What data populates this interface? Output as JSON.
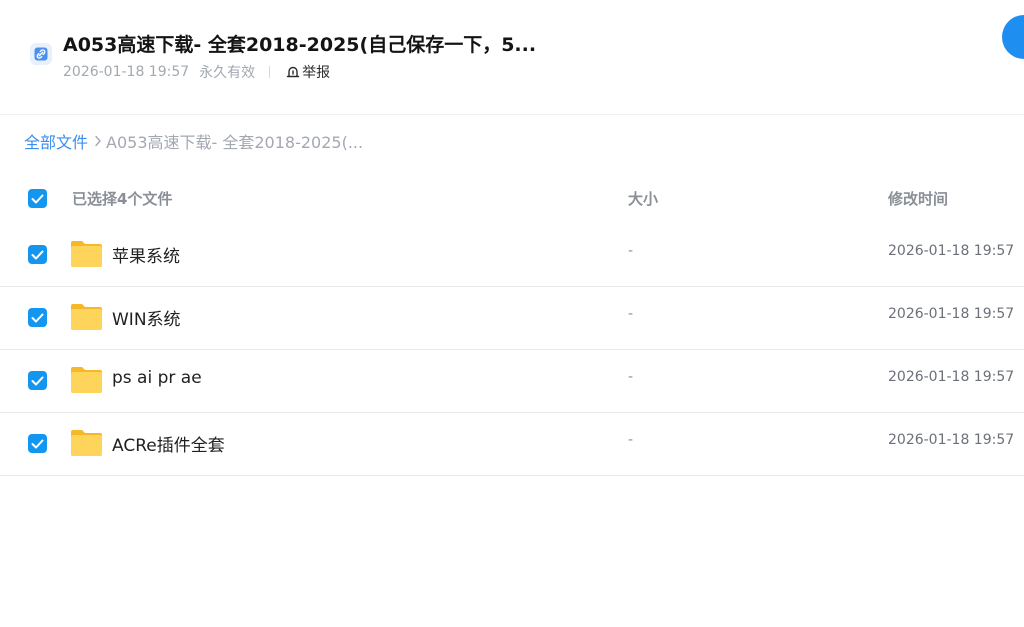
{
  "share": {
    "title": "A053高速下载- 全套2018-2025(自己保存一下，5...",
    "date": "2026-01-18 19:57",
    "validity": "永久有效",
    "report_label": "举报"
  },
  "breadcrumb": {
    "root": "全部文件",
    "current": "A053高速下载- 全套2018-2025(..."
  },
  "table": {
    "selection_label": "已选择4个文件",
    "size_header": "大小",
    "time_header": "修改时间",
    "rows": [
      {
        "name": "苹果系统",
        "size": "-",
        "modified": "2026-01-18 19:57",
        "checked": true
      },
      {
        "name": "WIN系统",
        "size": "-",
        "modified": "2026-01-18 19:57",
        "checked": true
      },
      {
        "name": "ps ai pr ae",
        "size": "-",
        "modified": "2026-01-18 19:57",
        "checked": true
      },
      {
        "name": "ACRe插件全套",
        "size": "-",
        "modified": "2026-01-18 19:57",
        "checked": true
      }
    ]
  },
  "icons": {
    "share_link": "link-icon",
    "report": "report-icon",
    "breadcrumb_separator": "chevron-right-icon",
    "folder": "folder-icon",
    "checkbox": "check-icon"
  },
  "colors": {
    "accent": "#1396f0",
    "link": "#3b8ef0",
    "folder": "#ffc83d"
  }
}
